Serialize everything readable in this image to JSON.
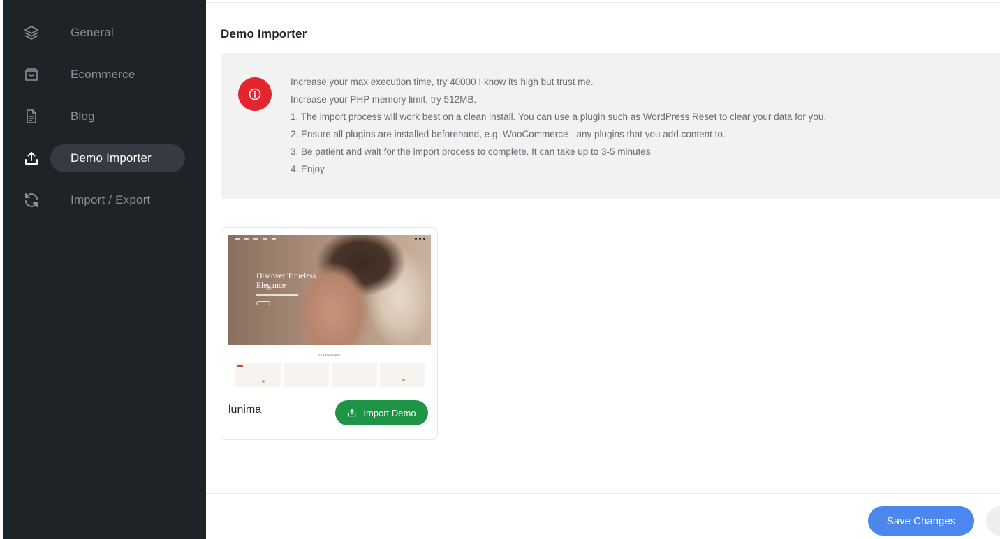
{
  "sidebar": {
    "items": [
      {
        "label": "General",
        "icon": "layers-icon",
        "active": false
      },
      {
        "label": "Ecommerce",
        "icon": "shopping-bag-icon",
        "active": false
      },
      {
        "label": "Blog",
        "icon": "document-icon",
        "active": false
      },
      {
        "label": "Demo Importer",
        "icon": "upload-icon",
        "active": true
      },
      {
        "label": "Import / Export",
        "icon": "refresh-icon",
        "active": false
      }
    ]
  },
  "main": {
    "title": "Demo Importer",
    "notice": {
      "icon": "info-icon",
      "lines": [
        "Increase your max execution time, try 40000 I know its high but trust me.",
        "Increase your PHP memory limit, try 512MB.",
        "1. The import process will work best on a clean install. You can use a plugin such as WordPress Reset to clear your data for you.",
        "2. Ensure all plugins are installed beforehand, e.g. WooCommerce - any plugins that you add content to.",
        "3. Be patient and wait for the import process to complete. It can take up to 3-5 minutes.",
        "4. Enjoy"
      ]
    },
    "demos": [
      {
        "name": "lunima",
        "preview_title": "Discover Timeless Elegance",
        "preview_section": "Gift Inspiration",
        "import_label": "Import Demo"
      }
    ]
  },
  "footer": {
    "save_label": "Save Changes"
  },
  "colors": {
    "sidebar_bg": "#1e2327",
    "active_pill": "#353b40",
    "notice_icon": "#e3262e",
    "import_button": "#1e9447",
    "save_button": "#4c87ee"
  }
}
